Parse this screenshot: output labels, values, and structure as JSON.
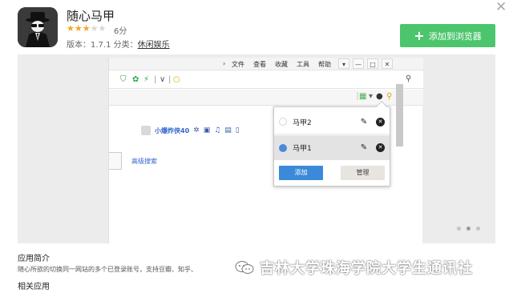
{
  "app": {
    "title": "随心马甲",
    "rating_stars": 3,
    "rating_max": 5,
    "score": "6分",
    "version_text": "版本：1.7.1  分类：",
    "category": "休闲娱乐",
    "add_button": "添加到浏览器",
    "icon_name": "spy-avatar-icon"
  },
  "preview": {
    "menu": [
      "文件",
      "查看",
      "收藏",
      "工具",
      "帮助"
    ],
    "user_name": "小爆炸侠40",
    "advanced_search": "高级搜索",
    "accounts": [
      {
        "name": "马甲2",
        "active": false
      },
      {
        "name": "马甲1",
        "active": true
      }
    ],
    "popup_add": "添加",
    "popup_manage": "管理",
    "carousel_pages": 3,
    "carousel_current": 1
  },
  "intro": {
    "heading": "应用简介",
    "text": "随心所欲的切换同一网站的多个已登录账号，支持豆瓣、知乎、",
    "related_heading": "相关应用"
  },
  "watermark": "吉林大学珠海学院大学生通讯社",
  "colors": {
    "accent_green": "#4cc56d",
    "accent_blue": "#3b8ad9",
    "star": "#f5a623"
  }
}
